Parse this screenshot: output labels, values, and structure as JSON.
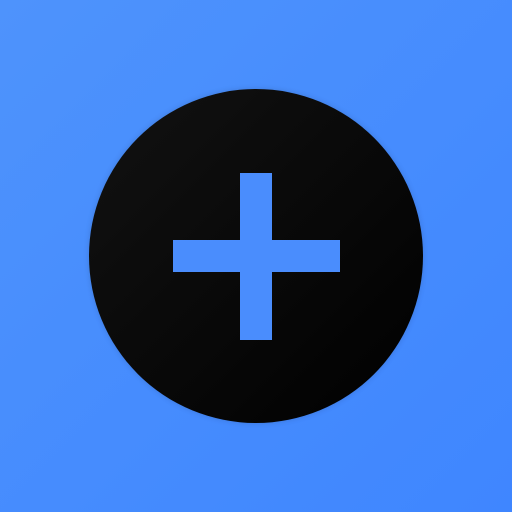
{
  "icon": {
    "name": "add-icon",
    "glyph": "plus",
    "colors": {
      "background_start": "#4E93FC",
      "background_end": "#3F86FF",
      "circle_start": "#121212",
      "circle_end": "#000000",
      "plus": "#4A8DFD"
    }
  }
}
